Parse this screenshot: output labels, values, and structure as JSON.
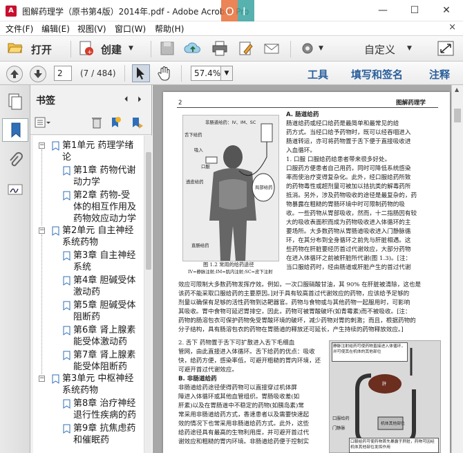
{
  "window": {
    "title": "图解药理学（原书第4版）2014年.pdf - Adobe Acrobat Pro",
    "minimize_glyph": "—",
    "maximize_glyph": "☐",
    "close_glyph": "✕"
  },
  "menu": {
    "items": [
      "文件(F)",
      "编辑(E)",
      "视图(V)",
      "窗口(W)",
      "帮助(H)"
    ],
    "close_glyph": "×"
  },
  "toolbar": {
    "open_label": "打开",
    "create_label": "创建",
    "customize_label": "自定义"
  },
  "nav": {
    "page_value": "2",
    "page_count": "(7 / 484)",
    "zoom_value": "57.4%",
    "tools_label": "工具",
    "sign_label": "填写和签名",
    "comment_label": "注释"
  },
  "bookmarks": {
    "title": "书签",
    "items": [
      {
        "l1": "第1单元  药理学绪",
        "l2": "论"
      },
      {
        "l1": "第1章  药物代谢",
        "l2": "动力学"
      },
      {
        "l1": "第2章  药物-受",
        "l2": "体的相互作用及",
        "l3": "药物效应动力学"
      },
      {
        "l1": "第2单元  自主神经",
        "l2": "系统药物"
      },
      {
        "l1": "第3章  自主神经",
        "l2": "系统"
      },
      {
        "l1": "第4章  胆碱受体",
        "l2": "激动药"
      },
      {
        "l1": "第5章  胆碱受体",
        "l2": "阻断药"
      },
      {
        "l1": "第6章  肾上腺素",
        "l2": "能受体激动药"
      },
      {
        "l1": "第7章  肾上腺素",
        "l2": "能受体阻断药"
      },
      {
        "l1": "第3单元  中枢神经",
        "l2": "系统药物"
      },
      {
        "l1": "第8章  治疗神经",
        "l2": "退行性疾病的药"
      },
      {
        "l1": "第9章  抗焦虑药",
        "l2": "和催眠药"
      }
    ]
  },
  "document": {
    "page_number": "2",
    "running_head": "图解药理学",
    "figure_labels": {
      "top": "非肠道给药：IV、IM、SC",
      "sublingual": "舌下给药",
      "inhalation": "吸入",
      "oral": "口服",
      "transdermal": "透皮给药",
      "topical": "局部给药",
      "rectal": "直肠给药"
    },
    "figure_caption": "图 1.2    常用的给药途径",
    "figure_subcaption": "IV=静脉注射;IM=肌内注射;SC=皮下注射",
    "right_col": [
      "A.  肠道给药",
      "    肠道给药或经口给药是最简单和最常见的给",
      "药方式。当经口给予药物时，既可以经吞咽进入",
      "肠道转运，亦可将药物置于舌下便于直接吸收进",
      "入血循环。",
      "1. 口服    口服给药给患者带来很多好处。",
      "口服药方便患者自己用药，同时可降低系统感染",
      "率而使治疗变得复杂化。此外，经口服给药所致",
      "的药物毒性或超剂量可被加以拮抗类的解毒药所",
      "抵消。另外，涉及药物吸收的途径是最复杂的，药",
      "物暴露在粗糙的胃肠环境中时可限制药物的吸",
      "收。一些药物从胃部吸收，然而，十二指肠因有较",
      "大的吸收表面积而成为药物吸收进入体循环的主",
      "要场所。大多数药物从胃肠道吸收进入门静脉循",
      "环，在其分布到全身循环之前先与肝脏相遇。这",
      "些药物在肝脏要经历首过代谢效应，大部分药物",
      "在进入体循环之前被肝脏所代谢(图 1.3)。[注：",
      "当口服给药时，经由肠道或肝脏产生的首过代谢"
    ],
    "full_width": [
      "效应可限制大多数药物发挥疗效。例如，一次口服硝酸甘油，其 90% 在肝脏被清除，这也是",
      "该药不能采取口服给药的主要原因。]对于具有较高首过代谢效应的药物，应该给予足够的",
      "剂量以确保有足够的活性药物到达靶器官。药物与食物或与其他药物一起服用时，可影响",
      "其吸收。胃中食物可延迟胃排空，因此，药物可被胃酸破坏(如青霉素)而不被吸收。[注：",
      "药物的肠溶包衣可保护药物免受胃酸环境的破坏，减少药物对胃的刺激；而且，根据药物的",
      "分子结构，具有肠溶包衣的药物在胃肠道的释放还可延长，产生持续的药物释放效应。]"
    ],
    "left_col2": [
      "2. 舌下    药物置于舌下可扩散进入舌下毛细血",
      "管网，由此直接进入体循环。舌下给药的优点：吸收",
      "快，给药方便，感染率低，可避开粗糙的胃内环境，还",
      "可避开首过代谢效应。",
      "B.  非肠道给药",
      "    非肠道给药途径使得药物可以直接穿过机体屏",
      "障进入体循环或其他血管组织。胃肠吸收差(如",
      "肝素)以及在胃肠道中不稳定的药物(如胰岛素)常",
      "常采用非肠道给药方式，香速患者以及需要快速起",
      "效的情况下也常采用非肠道给药方式。此外，这些",
      "给药途径具有最高的生物利用度，并可避开首过代",
      "谢效应和粗糙的胃内环境。非肠道给药便于控制实"
    ],
    "fig2_labels": {
      "top_note": "静脉注射给药可使药物直接进入体循环，并可使其在机体的其他部位",
      "oral": "口服给药",
      "liver": "肝",
      "portal": "门静脉",
      "kidney": "机体其他部位",
      "bottom_note": "口服给药可使药物首先暴露于肝脏，药物可因经机体其他部位发挥作用"
    }
  }
}
